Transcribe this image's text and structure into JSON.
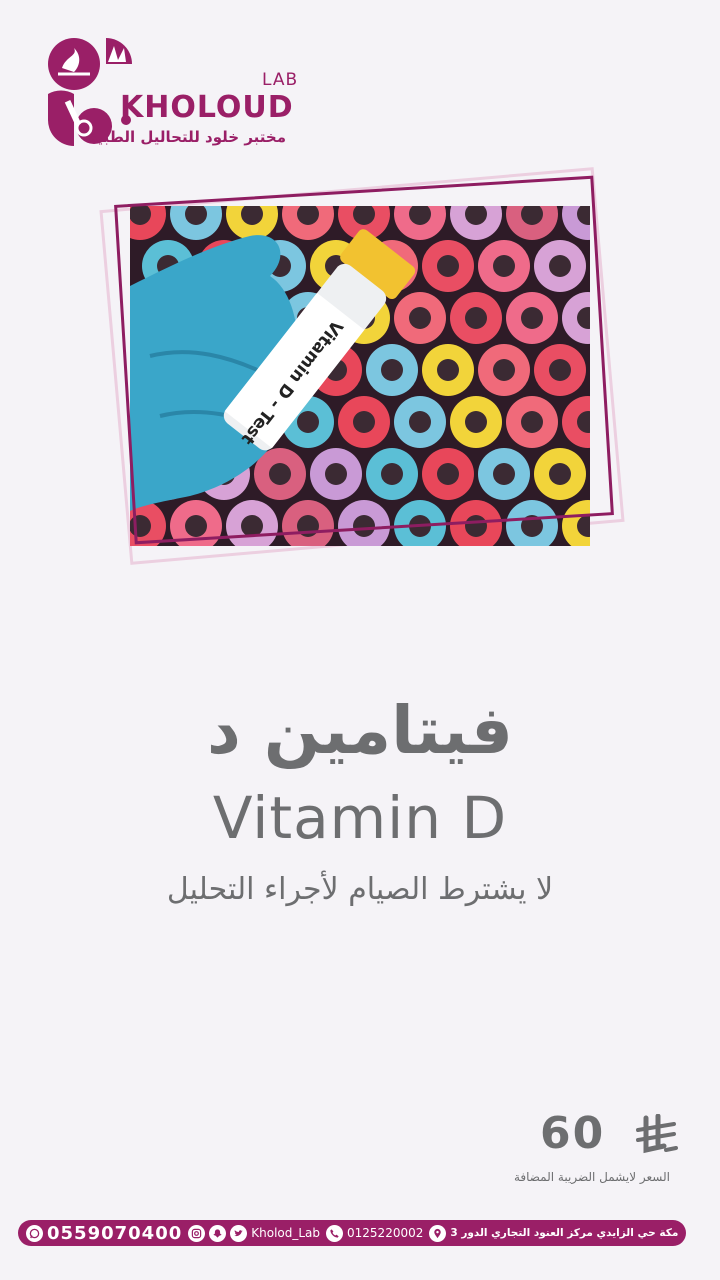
{
  "brand": {
    "lab_label": "LAB",
    "name": "KHOLOUD",
    "tagline_ar": "مختبر خلود للتحاليل الطبية",
    "color": "#9a1f67"
  },
  "photo": {
    "tube_label": "Vitamin D - Test"
  },
  "test": {
    "title_ar": "فيتامين  د",
    "title_en": "Vitamin D",
    "note_ar": "لا يشترط الصيام لأجراء التحليل"
  },
  "price": {
    "value": "60",
    "currency_icon": "saudi-riyal-icon",
    "note_ar": "السعر لايشمل الضريبة المضافة"
  },
  "footer": {
    "whatsapp": "0559070400",
    "social_handle": "Kholod_Lab",
    "phone": "0125220002",
    "address_ar": "مكة حي الزايدي مركز العنود التجاري الدور 3",
    "icons": [
      "whatsapp-icon",
      "instagram-icon",
      "snapchat-icon",
      "twitter-icon",
      "phone-icon",
      "location-icon"
    ]
  }
}
